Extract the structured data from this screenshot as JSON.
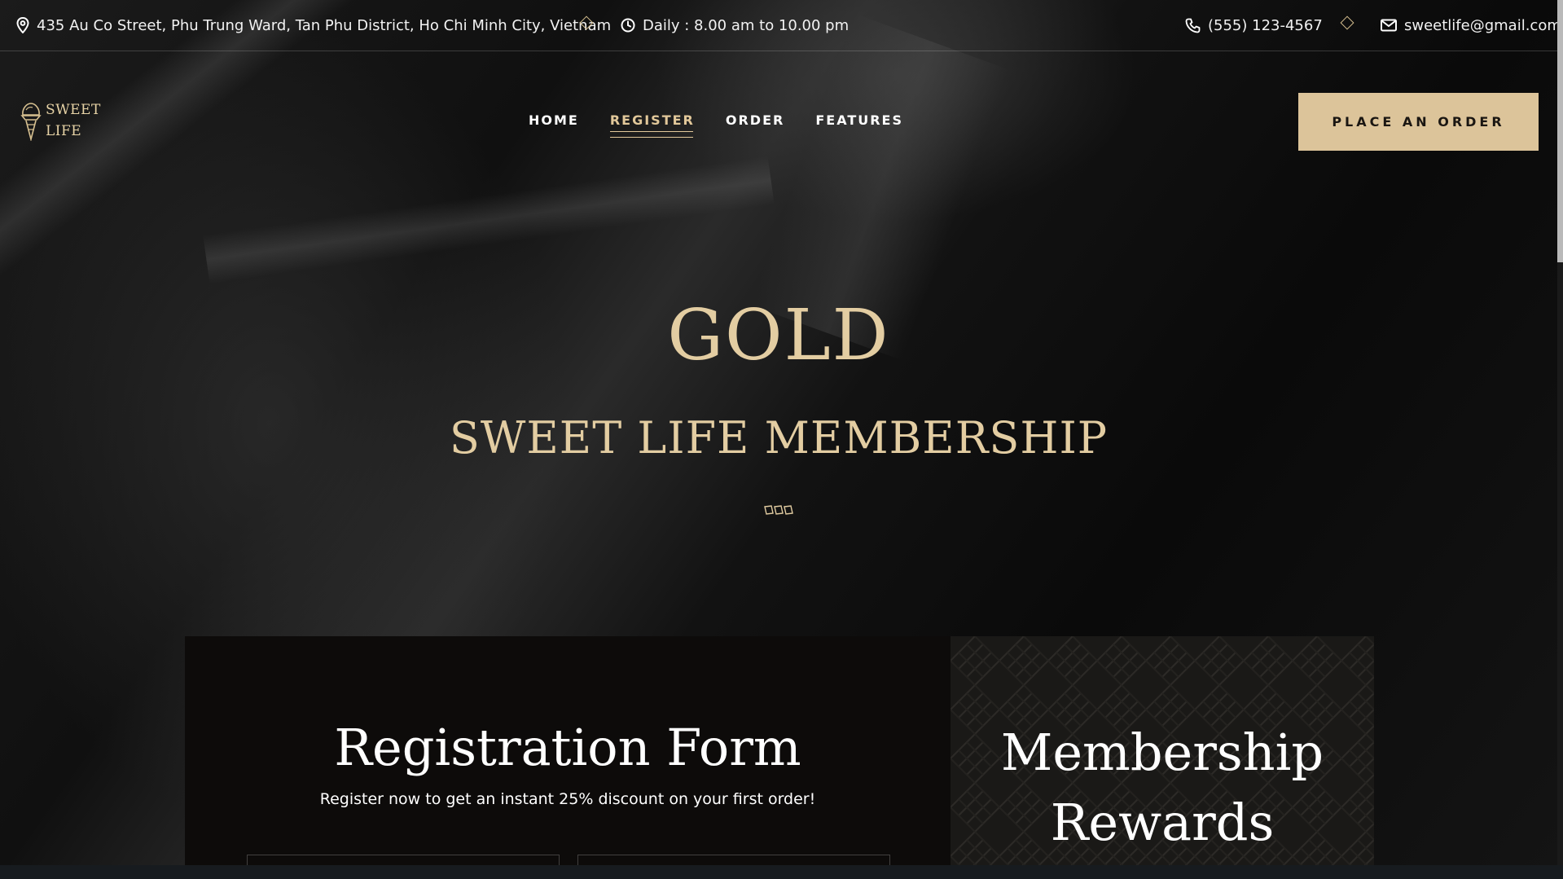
{
  "topbar": {
    "address": "435 Au Co Street, Phu Trung Ward, Tan Phu District, Ho Chi Minh City, Vietnam",
    "hours": "Daily : 8.00 am to 10.00 pm",
    "phone": "(555) 123-4567",
    "email": "sweetlife@gmail.com",
    "icons": [
      "location-pin-icon",
      "clock-icon",
      "phone-icon",
      "mail-icon"
    ]
  },
  "logo": {
    "line1": "SWEET",
    "line2": "LIFE"
  },
  "nav": {
    "items": [
      {
        "label": "HOME",
        "active": false
      },
      {
        "label": "REGISTER",
        "active": true
      },
      {
        "label": "ORDER",
        "active": false
      },
      {
        "label": "FEATURES",
        "active": false
      }
    ],
    "cta_label": "PLACE AN ORDER"
  },
  "hero": {
    "title": "GOLD",
    "subtitle": "SWEET LIFE MEMBERSHIP"
  },
  "registration": {
    "title": "Registration Form",
    "subtitle": "Register now to get an instant 25% discount on your first order!"
  },
  "rewards": {
    "title_line1": "Membership",
    "title_line2": "Rewards"
  },
  "colors": {
    "accent_gold": "#dcc49a",
    "background": "#0c0b0b",
    "text": "#ffffff"
  }
}
